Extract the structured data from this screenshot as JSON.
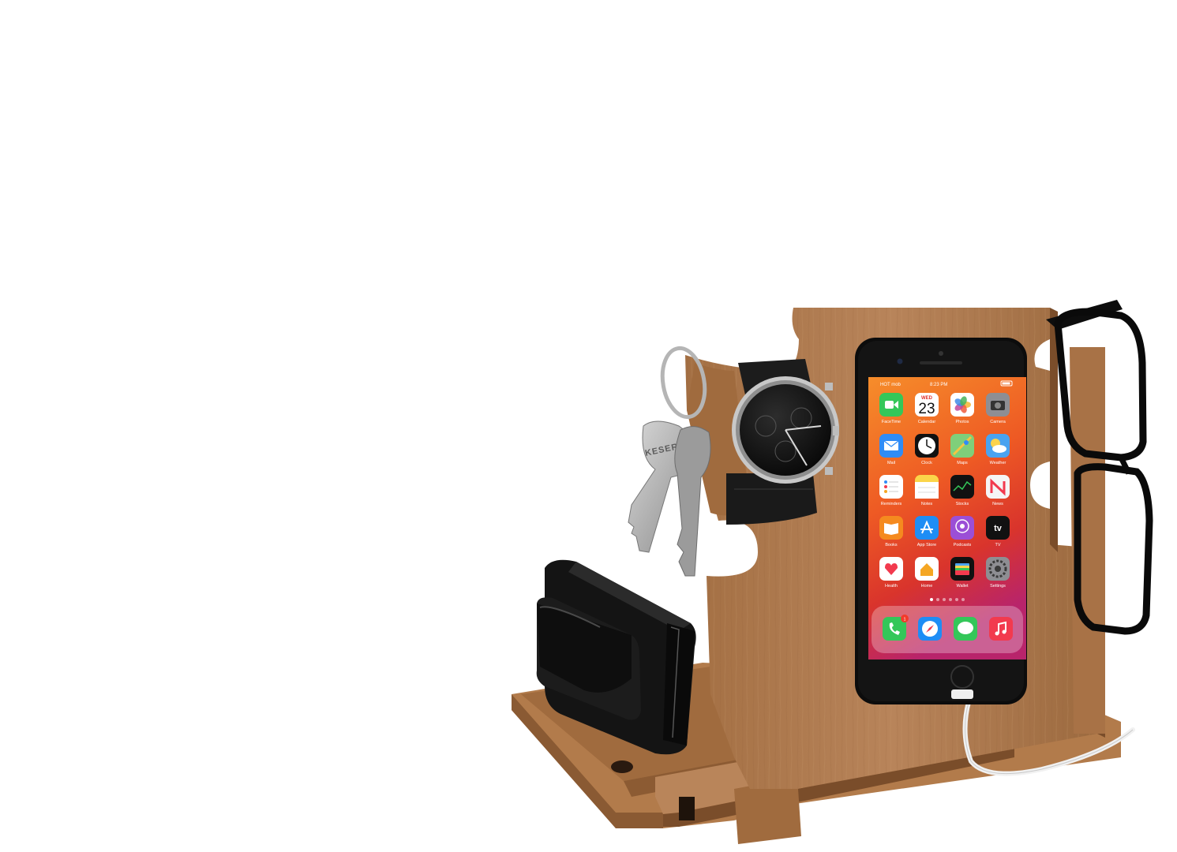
{
  "scene": {
    "subject": "wooden docking station with phone, watch, keys, wallet and glasses",
    "background_color": "#ffffff",
    "wood_color": "#b07a4c",
    "wood_dark_color": "#8f5f37"
  },
  "phone": {
    "status_bar": {
      "carrier": "HOT mob",
      "time": "8:23 PM"
    },
    "wallpaper_colors": [
      "#f27b1c",
      "#e23a2a",
      "#9c2a6e"
    ],
    "calendar": {
      "weekday": "WED",
      "day": "23"
    },
    "apps": [
      {
        "label": "FaceTime",
        "icon": "facetime-icon",
        "color": "#34c759"
      },
      {
        "label": "Calendar",
        "icon": "calendar-icon",
        "color": "#ffffff"
      },
      {
        "label": "Photos",
        "icon": "photos-icon",
        "color": "#ffffff"
      },
      {
        "label": "Camera",
        "icon": "camera-icon",
        "color": "#8e8e93"
      },
      {
        "label": "Mail",
        "icon": "mail-icon",
        "color": "#2f8cf7"
      },
      {
        "label": "Clock",
        "icon": "clock-icon",
        "color": "#111111"
      },
      {
        "label": "Maps",
        "icon": "maps-icon",
        "color": "#7fcf7a"
      },
      {
        "label": "Weather",
        "icon": "weather-icon",
        "color": "#4aa3f0"
      },
      {
        "label": "Reminders",
        "icon": "reminders-icon",
        "color": "#ffffff"
      },
      {
        "label": "Notes",
        "icon": "notes-icon",
        "color": "#fbd54a"
      },
      {
        "label": "Stocks",
        "icon": "stocks-icon",
        "color": "#111111"
      },
      {
        "label": "News",
        "icon": "news-icon",
        "color": "#f5f5f5"
      },
      {
        "label": "Books",
        "icon": "books-icon",
        "color": "#f58a1f"
      },
      {
        "label": "App Store",
        "icon": "app-store-icon",
        "color": "#1e8df5"
      },
      {
        "label": "Podcasts",
        "icon": "podcasts-icon",
        "color": "#9b4fd6"
      },
      {
        "label": "TV",
        "icon": "tv-icon",
        "color": "#111111"
      },
      {
        "label": "Health",
        "icon": "health-icon",
        "color": "#ffffff"
      },
      {
        "label": "Home",
        "icon": "home-icon",
        "color": "#ffffff"
      },
      {
        "label": "Wallet",
        "icon": "wallet-icon",
        "color": "#111111"
      },
      {
        "label": "Settings",
        "icon": "settings-icon",
        "color": "#8e8e93"
      }
    ],
    "tv_glyph": "tv",
    "dock": [
      {
        "icon": "phone-icon",
        "color": "#34c759",
        "badge": "1"
      },
      {
        "icon": "safari-icon",
        "color": "#1e8df5"
      },
      {
        "icon": "messages-icon",
        "color": "#34c759"
      },
      {
        "icon": "music-icon",
        "color": "#f23a4e"
      }
    ]
  },
  "keys": {
    "brand_stamp": "KESER"
  }
}
